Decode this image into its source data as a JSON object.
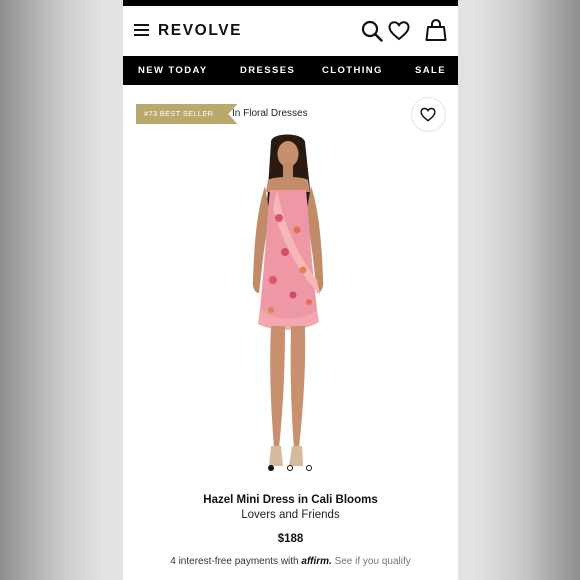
{
  "app": {
    "name": "REVOLVE"
  },
  "header": {
    "icons": [
      "menu-icon",
      "search-icon",
      "heart-icon",
      "shopping-bag-icon"
    ]
  },
  "nav": {
    "items": [
      "NEW TODAY",
      "DRESSES",
      "CLOTHING",
      "SALE"
    ]
  },
  "product": {
    "badge": "#73 BEST SELLER",
    "badge_context": "In Floral Dresses",
    "name": "Hazel Mini Dress in Cali Blooms",
    "brand": "Lovers and Friends",
    "price": "$188",
    "image_count": 3,
    "active_image": 1,
    "payments": {
      "prefix": "4 interest-free payments with",
      "provider": "affirm.",
      "link": "See if you qualify"
    }
  },
  "colors": {
    "badge": "#b9a96c",
    "nav_background": "#000000",
    "text": "#111111"
  }
}
